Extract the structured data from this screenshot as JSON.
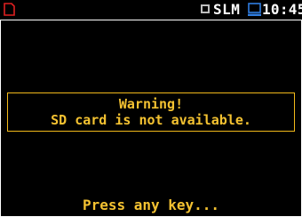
{
  "status_bar": {
    "mode_label": "SLM",
    "time": "10:45",
    "icons": {
      "sd_card": "sd-card-icon",
      "mode_indicator": "square-icon",
      "pc_connection": "computer-icon"
    },
    "colors": {
      "sd_card_icon": "#e02020",
      "pc_icon": "#2f7de0",
      "text": "#ffffff"
    }
  },
  "warning": {
    "title": "Warning!",
    "message": "SD card is not available.",
    "color": "#f4c231"
  },
  "footer": {
    "prompt": "Press any key..."
  }
}
